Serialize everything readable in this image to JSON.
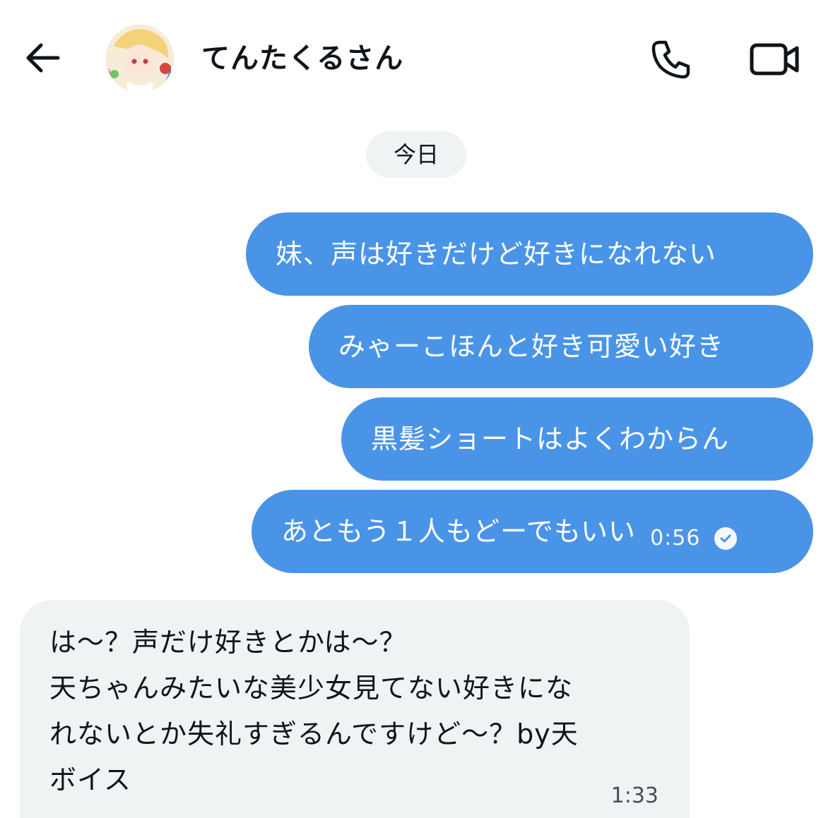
{
  "header": {
    "title": "てんたくるさん"
  },
  "date_divider": "今日",
  "messages_out": [
    {
      "text": "妹、声は好きだけど好きになれない"
    },
    {
      "text": "みゃーこほんと好き可愛い好き"
    },
    {
      "text": "黒髪ショートはよくわからん"
    },
    {
      "text": "あともう１人もどーでもいい",
      "time": "0:56",
      "status": "read"
    }
  ],
  "message_in": {
    "text": "は〜？声だけ好きとかは〜？\n天ちゃんみたいな美少女見てない好きにな\nれないとか失礼すぎるんですけど〜？by天\nボイス",
    "time": "1:33"
  },
  "colors": {
    "outgoing_bubble": "#4a94e8",
    "incoming_bubble": "#eff3f4",
    "date_pill": "#eff3f4"
  },
  "icons": [
    "arrow-left-icon",
    "phone-icon",
    "video-camera-icon",
    "read-check-icon"
  ]
}
